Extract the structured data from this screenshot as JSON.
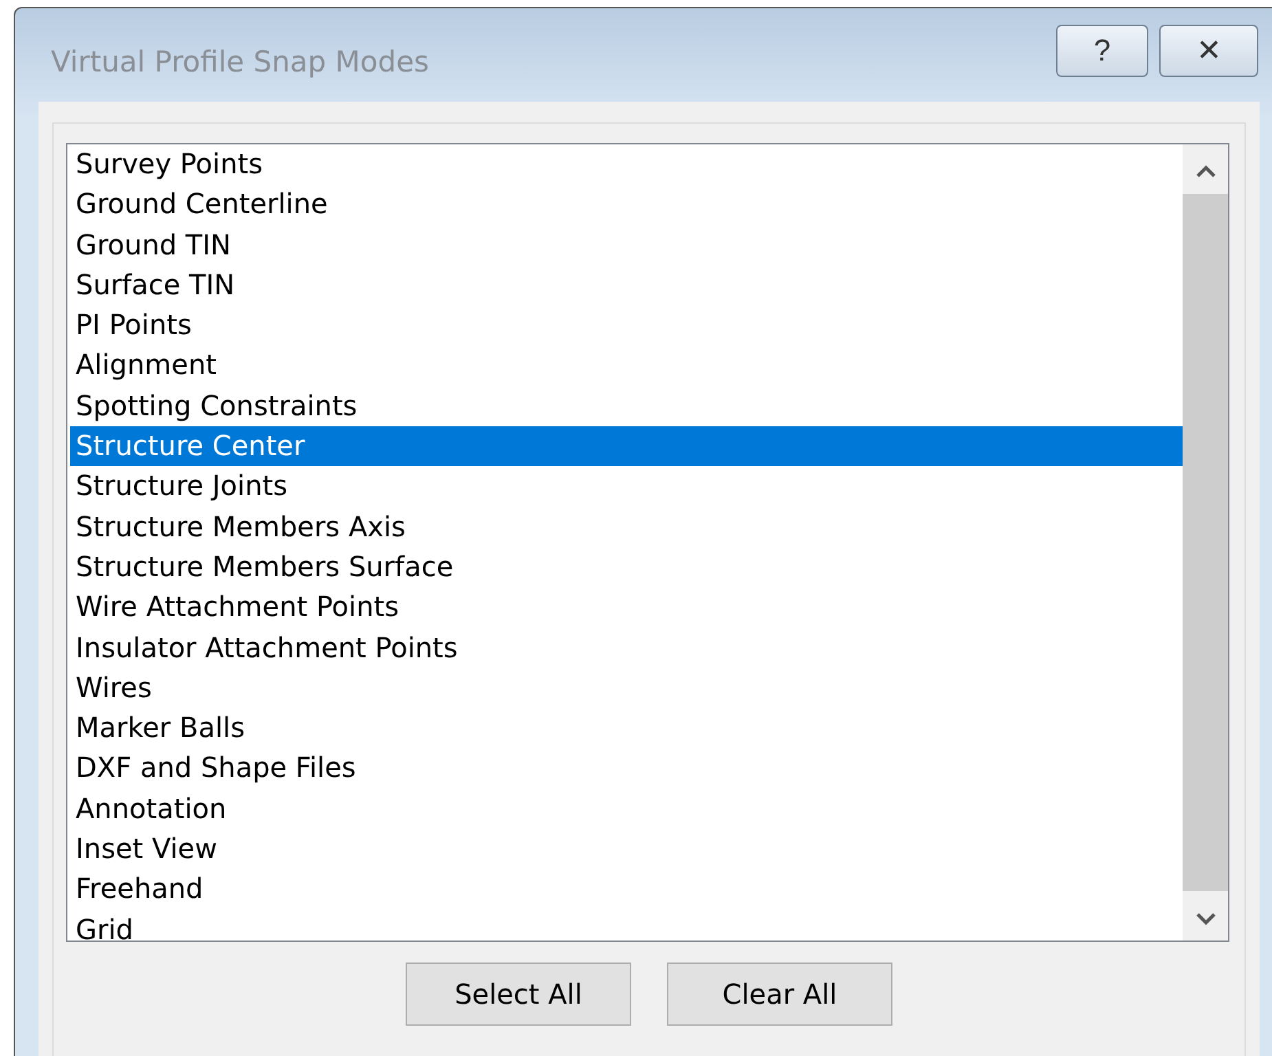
{
  "window": {
    "title": "Virtual Profile Snap Modes",
    "title_buttons": [
      "?",
      "✕"
    ]
  },
  "list": {
    "items": [
      {
        "label": "Survey Points",
        "selected": false
      },
      {
        "label": "Ground Centerline",
        "selected": false
      },
      {
        "label": "Ground TIN",
        "selected": false
      },
      {
        "label": "Surface TIN",
        "selected": false
      },
      {
        "label": "PI Points",
        "selected": false
      },
      {
        "label": "Alignment",
        "selected": false
      },
      {
        "label": "Spotting Constraints",
        "selected": false
      },
      {
        "label": "Structure Center",
        "selected": true
      },
      {
        "label": "Structure Joints",
        "selected": false
      },
      {
        "label": "Structure Members Axis",
        "selected": false
      },
      {
        "label": "Structure Members Surface",
        "selected": false
      },
      {
        "label": "Wire Attachment Points",
        "selected": false
      },
      {
        "label": "Insulator Attachment Points",
        "selected": false
      },
      {
        "label": "Wires",
        "selected": false
      },
      {
        "label": "Marker Balls",
        "selected": false
      },
      {
        "label": "DXF and Shape Files",
        "selected": false
      },
      {
        "label": "Annotation",
        "selected": false
      },
      {
        "label": "Inset View",
        "selected": false
      },
      {
        "label": "Freehand",
        "selected": false
      },
      {
        "label": "Grid",
        "selected": false
      }
    ]
  },
  "buttons": [
    "Select All",
    "Clear All"
  ]
}
